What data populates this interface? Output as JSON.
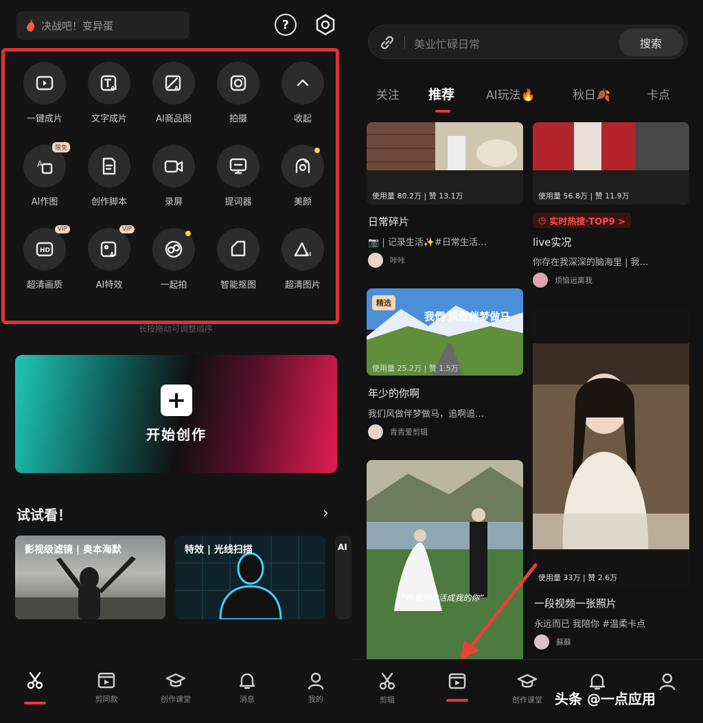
{
  "left": {
    "search_placeholder": "决战吧！变异蛋",
    "tools": [
      {
        "label": "一键成片",
        "icon": "play-rect-icon"
      },
      {
        "label": "文字成片",
        "icon": "text-ai-icon"
      },
      {
        "label": "AI商品图",
        "icon": "ai-image-icon"
      },
      {
        "label": "拍摄",
        "icon": "camera-icon"
      },
      {
        "label": "收起",
        "icon": "chevron-up-icon"
      },
      {
        "label": "AI作图",
        "icon": "ai-draw-icon",
        "badge": "限免"
      },
      {
        "label": "创作脚本",
        "icon": "script-icon"
      },
      {
        "label": "录屏",
        "icon": "record-icon"
      },
      {
        "label": "提词器",
        "icon": "teleprompter-icon"
      },
      {
        "label": "美颜",
        "icon": "beauty-icon",
        "dot": true
      },
      {
        "label": "超清画质",
        "icon": "hd-icon",
        "badge": "VIP"
      },
      {
        "label": "AI特效",
        "icon": "ai-effect-icon",
        "badge": "VIP"
      },
      {
        "label": "一起拍",
        "icon": "together-icon",
        "dot": true
      },
      {
        "label": "智能抠图",
        "icon": "cutout-icon"
      },
      {
        "label": "超清图片",
        "icon": "hd-image-icon"
      }
    ],
    "hint": "长按拖动可调整顺序",
    "start_label": "开始创作",
    "try_title": "试试看！",
    "try_cards": [
      "影视级滤镜 | 奥本海默",
      "特效 | 光线扫描",
      "AI"
    ],
    "nav": [
      {
        "label": "",
        "icon": "scissors-icon"
      },
      {
        "label": "剪同款",
        "icon": "template-icon"
      },
      {
        "label": "创作课堂",
        "icon": "graduation-cap-icon"
      },
      {
        "label": "消息",
        "icon": "bell-icon"
      },
      {
        "label": "我的",
        "icon": "profile-icon"
      }
    ]
  },
  "right": {
    "search_placeholder": "美业忙碌日常",
    "search_button": "搜索",
    "tabs": [
      "关注",
      "推荐",
      "AI玩法🔥",
      "秋日🍂",
      "卡点"
    ],
    "feed": [
      {
        "stats": "使用量 80.2万 | 赞 13.1万",
        "title": "日常碎片",
        "desc": "📷 | 记录生活✨#日常生活…",
        "author": "咔咔"
      },
      {
        "stats": "使用量 56.8万 | 赞 11.9万",
        "hot": "实时热搜·TOP9 >",
        "title": "live实况",
        "desc": "你存在我深深的脑海里 | 我…",
        "author": "烦恼远离我"
      },
      {
        "stats": "使用量 25.2万 | 赞 1.5万",
        "tag": "精选",
        "overlay": "我們 风做伴梦做马",
        "title": "年少的你啊",
        "desc": "我们风做伴梦做马，追啊追…",
        "author": "青青爱剪辑"
      },
      {
        "stats": "使用量 33万 | 赞 2.6万",
        "title": "一段视频一张照片",
        "desc": "永远而已 我陪你 #温柔卡点",
        "author": "蘇蘇"
      }
    ],
    "wedding_caption": "“作者你能活成我的你”",
    "nav": [
      {
        "label": "剪辑",
        "icon": "scissors-icon"
      },
      {
        "label": "",
        "icon": "template-icon"
      },
      {
        "label": "创作课堂",
        "icon": "graduation-cap-icon"
      },
      {
        "label": "",
        "icon": "bell-icon"
      },
      {
        "label": "",
        "icon": "profile-icon"
      }
    ]
  },
  "watermark": "头条 @一点应用",
  "colors": {
    "accent": "#e6364a",
    "highlight_box": "#e0303a"
  }
}
